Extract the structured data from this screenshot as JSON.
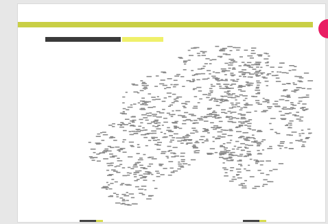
{
  "document": {
    "section_label": "",
    "badge_text": "",
    "title": "",
    "subtitle": "",
    "intro_text": "",
    "link_text": ""
  },
  "colors": {
    "accent": "#c9cf45",
    "badge": "#e91e63",
    "link": "#3eb0a2",
    "highlight": "#eff06a"
  }
}
